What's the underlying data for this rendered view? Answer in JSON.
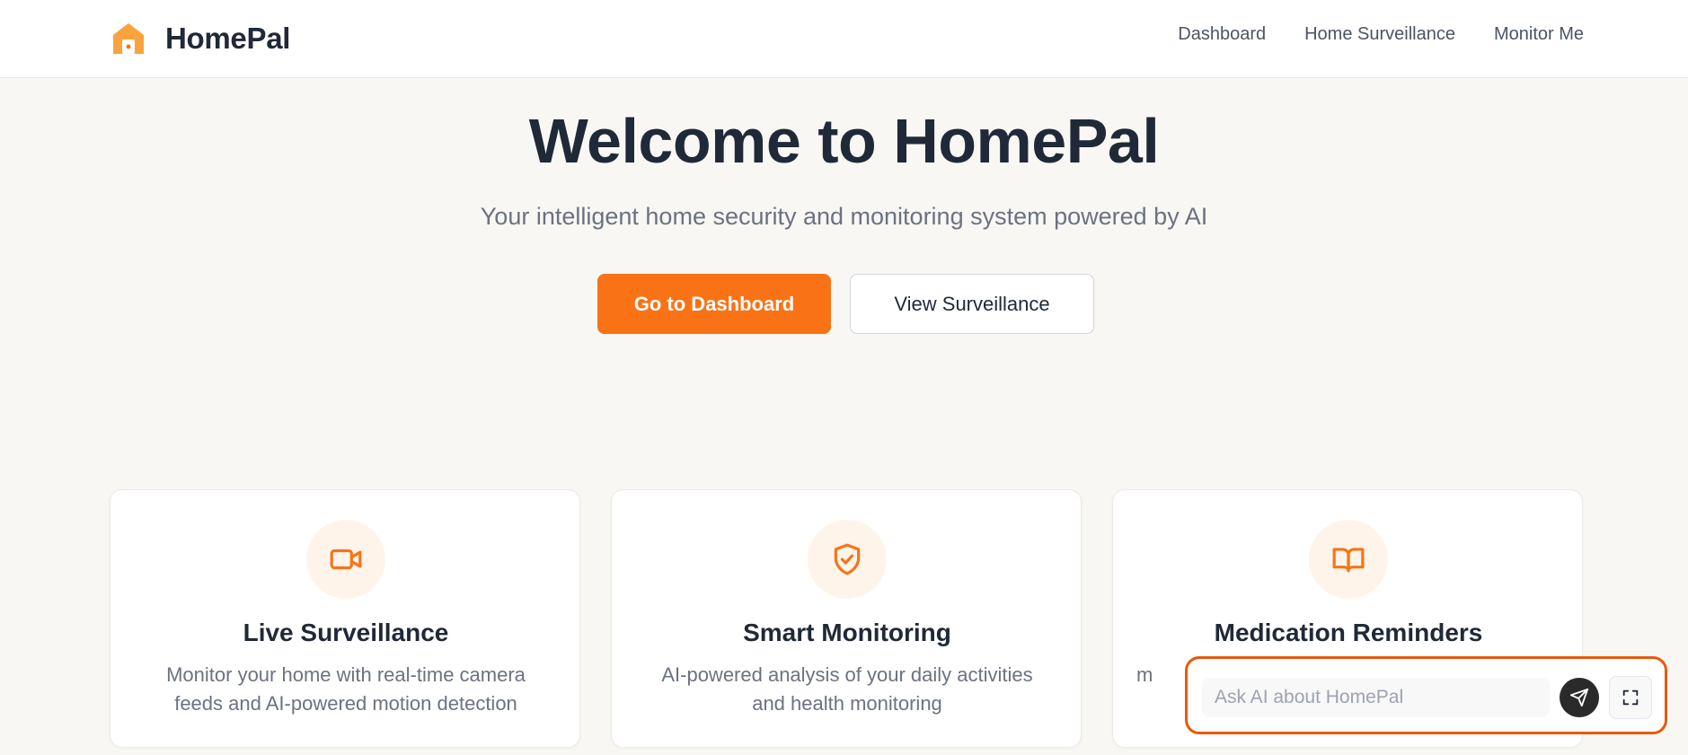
{
  "brand": {
    "name": "HomePal",
    "logo_icon": "home-icon",
    "accent": "#f97316"
  },
  "nav": [
    {
      "label": "Dashboard"
    },
    {
      "label": "Home Surveillance"
    },
    {
      "label": "Monitor Me"
    }
  ],
  "hero": {
    "title": "Welcome to HomePal",
    "subtitle": "Your intelligent home security and monitoring system powered by AI",
    "primary_button": "Go to Dashboard",
    "secondary_button": "View Surveillance"
  },
  "features": [
    {
      "icon": "video-camera-icon",
      "title": "Live Surveillance",
      "description": "Monitor your home with real-time camera feeds and AI-powered motion detection"
    },
    {
      "icon": "shield-check-icon",
      "title": "Smart Monitoring",
      "description": "AI-powered analysis of your daily activities and health monitoring"
    },
    {
      "icon": "book-open-icon",
      "title": "Medication Reminders",
      "description": "m"
    }
  ],
  "chat": {
    "placeholder": "Ask AI about HomePal",
    "send_icon": "send-icon",
    "expand_icon": "expand-icon",
    "border_color": "#ea580c"
  }
}
